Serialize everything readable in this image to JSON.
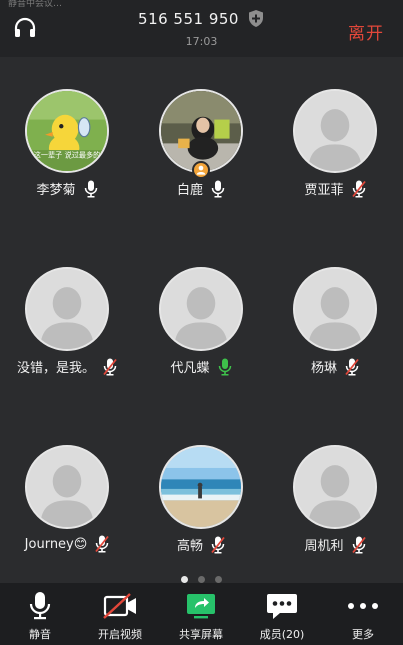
{
  "header": {
    "status_text": "静音中会议…",
    "meeting_id": "516 551 950",
    "time": "17:03",
    "leave_label": "离开"
  },
  "participants": [
    {
      "name": "李梦菊",
      "mic": "on",
      "avatar": "duck-photo",
      "avatar_caption": "我这一辈子 说过最多的话"
    },
    {
      "name": "白鹿",
      "mic": "on",
      "avatar": "person-photo",
      "host": true
    },
    {
      "name": "贾亚菲",
      "mic": "muted",
      "avatar": "default"
    },
    {
      "name": "没错，是我。",
      "mic": "muted",
      "avatar": "default"
    },
    {
      "name": "代凡蝶",
      "mic": "speaking",
      "avatar": "default"
    },
    {
      "name": "杨琳",
      "mic": "muted",
      "avatar": "default"
    },
    {
      "name": "Journey😊",
      "mic": "muted",
      "avatar": "default"
    },
    {
      "name": "高畅",
      "mic": "muted",
      "avatar": "beach-photo"
    },
    {
      "name": "周机利",
      "mic": "muted",
      "avatar": "default"
    }
  ],
  "pagination": {
    "pages": 3,
    "current": 1
  },
  "toolbar": {
    "mute_label": "静音",
    "video_label": "开启视频",
    "share_label": "共享屏幕",
    "members_label": "成员(20)",
    "more_label": "更多"
  },
  "colors": {
    "leave": "#e2473a",
    "speaking_mic": "#3ec24b",
    "muted_slash": "#e2473a",
    "share_icon": "#27c26a",
    "background": "#2b2c2e"
  },
  "icons": [
    "headset-icon",
    "shield-plus-icon",
    "microphone-icon",
    "muted-microphone-icon",
    "video-off-icon",
    "share-screen-icon",
    "chat-members-icon",
    "more-dots-icon",
    "host-badge-icon"
  ]
}
